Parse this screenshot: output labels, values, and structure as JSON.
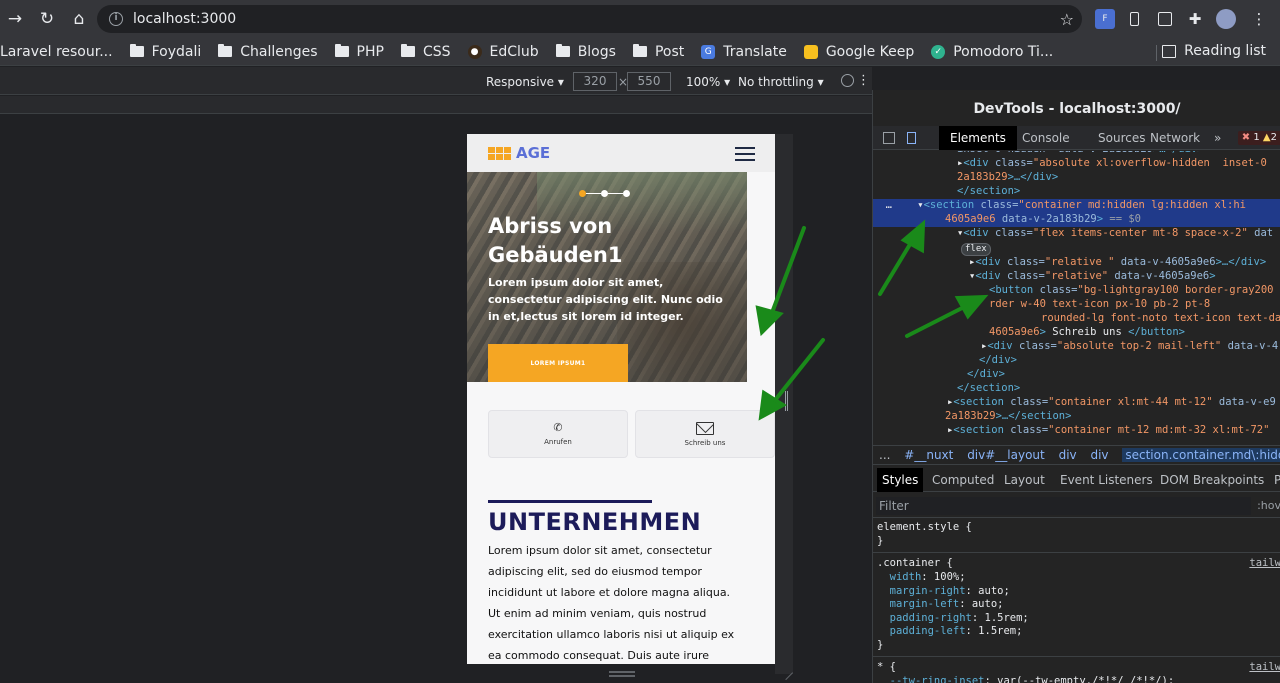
{
  "browser": {
    "url": "localhost:3000",
    "bookmarks": [
      {
        "label": "Laravel resour...",
        "type": "none"
      },
      {
        "label": "Foydali",
        "type": "folder"
      },
      {
        "label": "Challenges",
        "type": "folder"
      },
      {
        "label": "PHP",
        "type": "folder"
      },
      {
        "label": "CSS",
        "type": "folder"
      },
      {
        "label": "EdClub",
        "type": "site"
      },
      {
        "label": "Blogs",
        "type": "folder"
      },
      {
        "label": "Post",
        "type": "folder"
      },
      {
        "label": "Translate",
        "type": "site"
      },
      {
        "label": "Google Keep",
        "type": "site"
      },
      {
        "label": "Pomodoro Ti...",
        "type": "site"
      }
    ],
    "reading_list": "Reading list"
  },
  "device_toolbar": {
    "mode": "Responsive ▾",
    "width": "320",
    "times": "×",
    "height": "550",
    "zoom": "100% ▾",
    "throttle": "No throttling ▾"
  },
  "mobile_page": {
    "logo": "AGE",
    "hero_title": "Abriss von Gebäuden1",
    "hero_text": "Lorem ipsum dolor sit amet, consectetur adipiscing elit. Nunc odio in et,lectus sit lorem id integer.",
    "hero_button": "LOREM IPSUM1",
    "call_label": "Anrufen",
    "write_label": "Schreib uns",
    "section_title": "UNTERNEHMEN",
    "section_text": "Lorem ipsum dolor sit amet, consectetur adipiscing elit, sed do eiusmod tempor incididunt ut labore et dolore magna aliqua. Ut enim ad minim veniam, quis nostrud exercitation ullamco laboris nisi ut aliquip ex ea commodo consequat. Duis aute irure dolor in"
  },
  "devtools": {
    "title": "DevTools - localhost:3000/",
    "tabs": [
      "Elements",
      "Console",
      "Sources",
      "Network",
      "»"
    ],
    "errors": "1",
    "warnings": "2",
    "breadcrumbs": [
      "...",
      "#__nuxt",
      "div#__layout",
      "div",
      "div",
      "section.container.md\\:hidden.lg\\:hid"
    ],
    "styles_tabs": [
      "Styles",
      "Computed",
      "Layout",
      "Event Listeners",
      "DOM Breakpoints",
      "P"
    ],
    "filter_placeholder": "Filter",
    "hov": ":hov",
    "source_link": "tailw"
  },
  "colors": {
    "accent_orange": "#f5a623",
    "logo_blue": "#5b6fd6",
    "heading_navy": "#1c1b5a",
    "annotation_arrow": "#1a8a1a"
  }
}
